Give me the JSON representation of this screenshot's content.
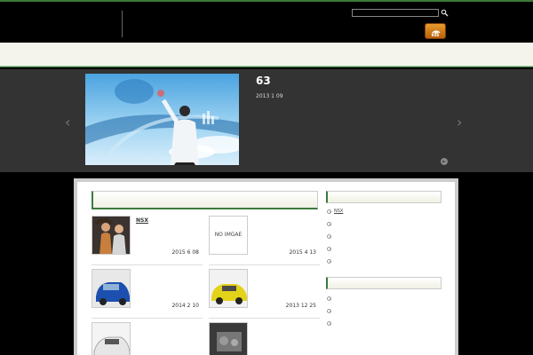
{
  "header": {
    "search": {
      "placeholder": ""
    },
    "rss": {
      "label": "RSS"
    }
  },
  "slider": {
    "title": "63",
    "date": "2013 1 09"
  },
  "posts": [
    {
      "title": "NSX",
      "date": "2015 6 08",
      "thumb": "photo"
    },
    {
      "title": "",
      "date": "2015 4 13",
      "thumb": "NO IMGAE"
    },
    {
      "title": "",
      "date": "2014 2 10",
      "thumb": "photo"
    },
    {
      "title": "",
      "date": "2013 12 25",
      "thumb": "photo"
    },
    {
      "title": "",
      "date": "",
      "thumb": "photo"
    },
    {
      "title": "",
      "date": "",
      "thumb": "photo"
    }
  ],
  "sidebar": {
    "section1_items": [
      "NSX",
      "",
      "",
      "",
      ""
    ],
    "section2_items": [
      "",
      "",
      ""
    ]
  },
  "colors": {
    "accent": "#3d7a3d",
    "background": "#000000",
    "slider_bg": "#333333"
  }
}
